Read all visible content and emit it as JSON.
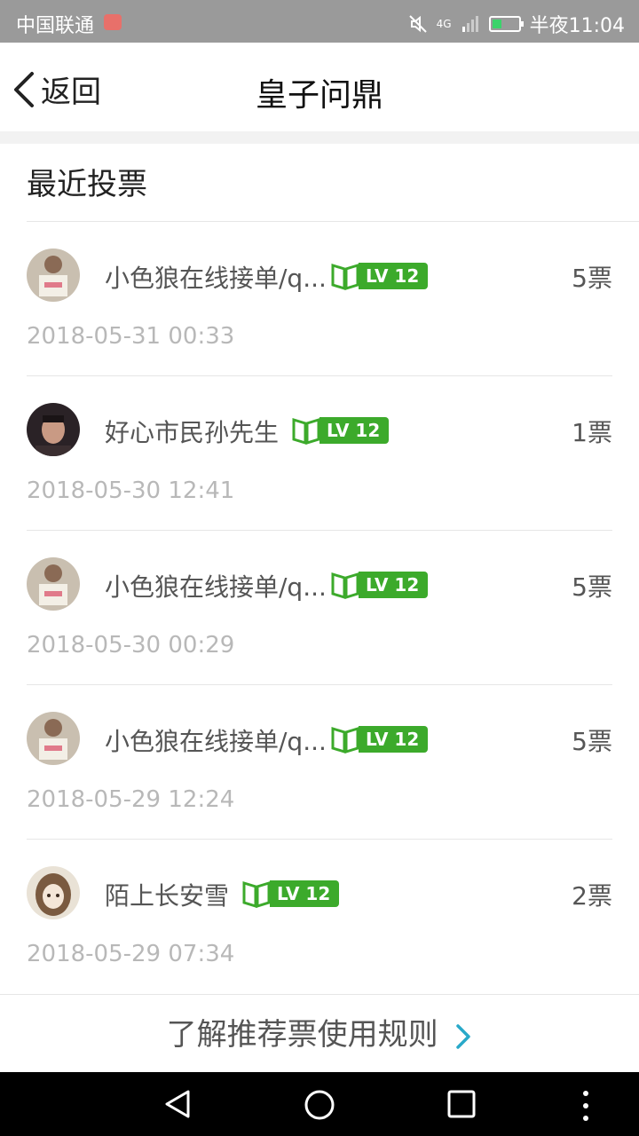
{
  "status": {
    "carrier": "中国联通",
    "network": "4G",
    "time": "半夜11:04"
  },
  "header": {
    "back_label": "返回",
    "title": "皇子问鼎"
  },
  "section": {
    "title": "最近投票"
  },
  "votes": [
    {
      "name": "小色狼在线接单/q...",
      "level": "LV 12",
      "votes": "5票",
      "time": "2018-05-31 00:33"
    },
    {
      "name": "好心市民孙先生",
      "level": "LV 12",
      "votes": "1票",
      "time": "2018-05-30 12:41"
    },
    {
      "name": "小色狼在线接单/q...",
      "level": "LV 12",
      "votes": "5票",
      "time": "2018-05-30 00:29"
    },
    {
      "name": "小色狼在线接单/q...",
      "level": "LV 12",
      "votes": "5票",
      "time": "2018-05-29 12:24"
    },
    {
      "name": "陌上长安雪",
      "level": "LV 12",
      "votes": "2票",
      "time": "2018-05-29 07:34"
    }
  ],
  "footer": {
    "link_label": "了解推荐票使用规则"
  },
  "colors": {
    "accent_green": "#3caa2b",
    "link_chevron": "#29a9c9",
    "statusbar": "#9a9a9a"
  }
}
